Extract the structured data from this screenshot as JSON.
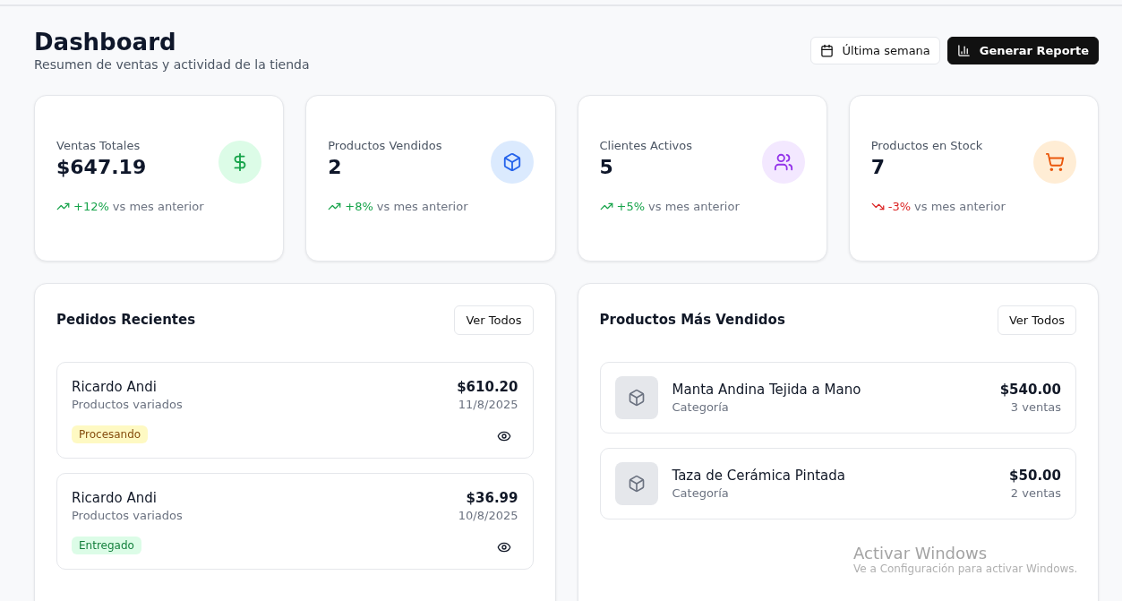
{
  "header": {
    "title": "Dashboard",
    "subtitle": "Resumen de ventas y actividad de la tienda",
    "buttons": [
      {
        "label": "Última semana",
        "kind": "outline"
      },
      {
        "label": "Generar Reporte",
        "kind": "primary"
      }
    ]
  },
  "stats": [
    {
      "label": "Ventas Totales",
      "value": "$647.19",
      "kind": "sales",
      "color": "#dcfce7",
      "change": "+12%",
      "rising": true,
      "note": "vs mes anterior"
    },
    {
      "label": "Productos Vendidos",
      "value": "2",
      "kind": "products",
      "color": "#dbeafe",
      "change": "+8%",
      "rising": true,
      "note": "vs mes anterior"
    },
    {
      "label": "Clientes Activos",
      "value": "5",
      "kind": "clients",
      "color": "#f3e8ff",
      "change": "+5%",
      "rising": true,
      "note": "vs mes anterior"
    },
    {
      "label": "Productos en Stock",
      "value": "7",
      "kind": "stock",
      "color": "#ffedd5",
      "change": "-3%",
      "rising": false,
      "note": "vs mes anterior"
    }
  ],
  "recent_orders": {
    "title": "Pedidos Recientes",
    "button": "Ver Todos",
    "orders": [
      {
        "customer": "Ricardo Andi",
        "detail": "Productos variados",
        "total": "$610.20",
        "date": "11/8/2025",
        "status": "Procesando",
        "color": "#fef9c3"
      },
      {
        "customer": "Ricardo Andi",
        "detail": "Productos variados",
        "total": "$36.99",
        "date": "10/8/2025",
        "status": "Entregado",
        "color": "#dcfce7"
      }
    ]
  },
  "top_products": {
    "title": "Productos Más Vendidos",
    "button": "Ver Todos",
    "products": [
      {
        "name": "Manta Andina Tejida a Mano",
        "category": "Categoría",
        "revenue": "$540.00",
        "sales": "3 ventas"
      },
      {
        "name": "Taza de Cerámica Pintada",
        "category": "Categoría",
        "revenue": "$50.00",
        "sales": "2 ventas"
      }
    ]
  },
  "os_watermark": {
    "title": "Activar Windows",
    "text": "Ve a Configuración para activar Windows."
  }
}
